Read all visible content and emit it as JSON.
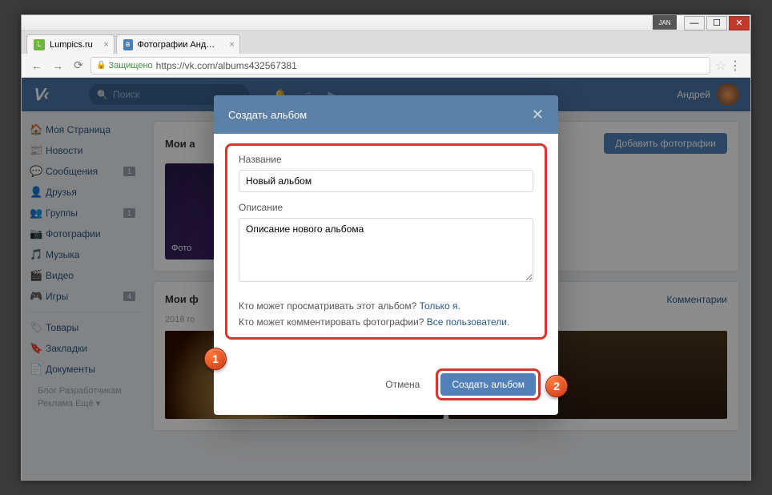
{
  "window": {
    "jan": "JAN",
    "min": "—",
    "max": "☐",
    "close": "✕"
  },
  "tabs": [
    {
      "title": "Lumpics.ru"
    },
    {
      "title": "Фотографии Андрея Пе"
    }
  ],
  "address": {
    "secure": "Защищено",
    "url": "https://vk.com/albums432567381"
  },
  "header": {
    "logo": "VK",
    "search_placeholder": "Поиск",
    "username": "Андрей"
  },
  "sidebar": {
    "items": [
      {
        "icon": "🏠",
        "label": "Моя Страница",
        "badge": ""
      },
      {
        "icon": "📰",
        "label": "Новости",
        "badge": ""
      },
      {
        "icon": "💬",
        "label": "Сообщения",
        "badge": "1"
      },
      {
        "icon": "👤",
        "label": "Друзья",
        "badge": ""
      },
      {
        "icon": "👥",
        "label": "Группы",
        "badge": "1"
      },
      {
        "icon": "📷",
        "label": "Фотографии",
        "badge": ""
      },
      {
        "icon": "🎵",
        "label": "Музыка",
        "badge": ""
      },
      {
        "icon": "🎬",
        "label": "Видео",
        "badge": ""
      },
      {
        "icon": "🎮",
        "label": "Игры",
        "badge": "4"
      }
    ],
    "items2": [
      {
        "icon": "🏷",
        "label": "Товары"
      },
      {
        "icon": "🔖",
        "label": "Закладки"
      },
      {
        "icon": "📄",
        "label": "Документы"
      }
    ],
    "footer1": "Блог   Разработчикам",
    "footer2": "Реклама   Ещё ▾"
  },
  "page": {
    "albums_title": "Мои а",
    "add_photos": "Добавить фотографии",
    "album_thumb": "Фото",
    "my_photos_title": "Мои ф",
    "comments": "Комментарии",
    "year": "2018 го"
  },
  "modal": {
    "title": "Создать альбом",
    "label_name": "Название",
    "value_name": "Новый альбом",
    "label_desc": "Описание",
    "value_desc": "Описание нового альбома",
    "priv_view_q": "Кто может просматривать этот альбом? ",
    "priv_view_a": "Только я.",
    "priv_comment_q": "Кто может комментировать фотографии? ",
    "priv_comment_a": "Все пользователи.",
    "cancel": "Отмена",
    "create": "Создать альбом"
  },
  "markers": {
    "one": "1",
    "two": "2"
  }
}
